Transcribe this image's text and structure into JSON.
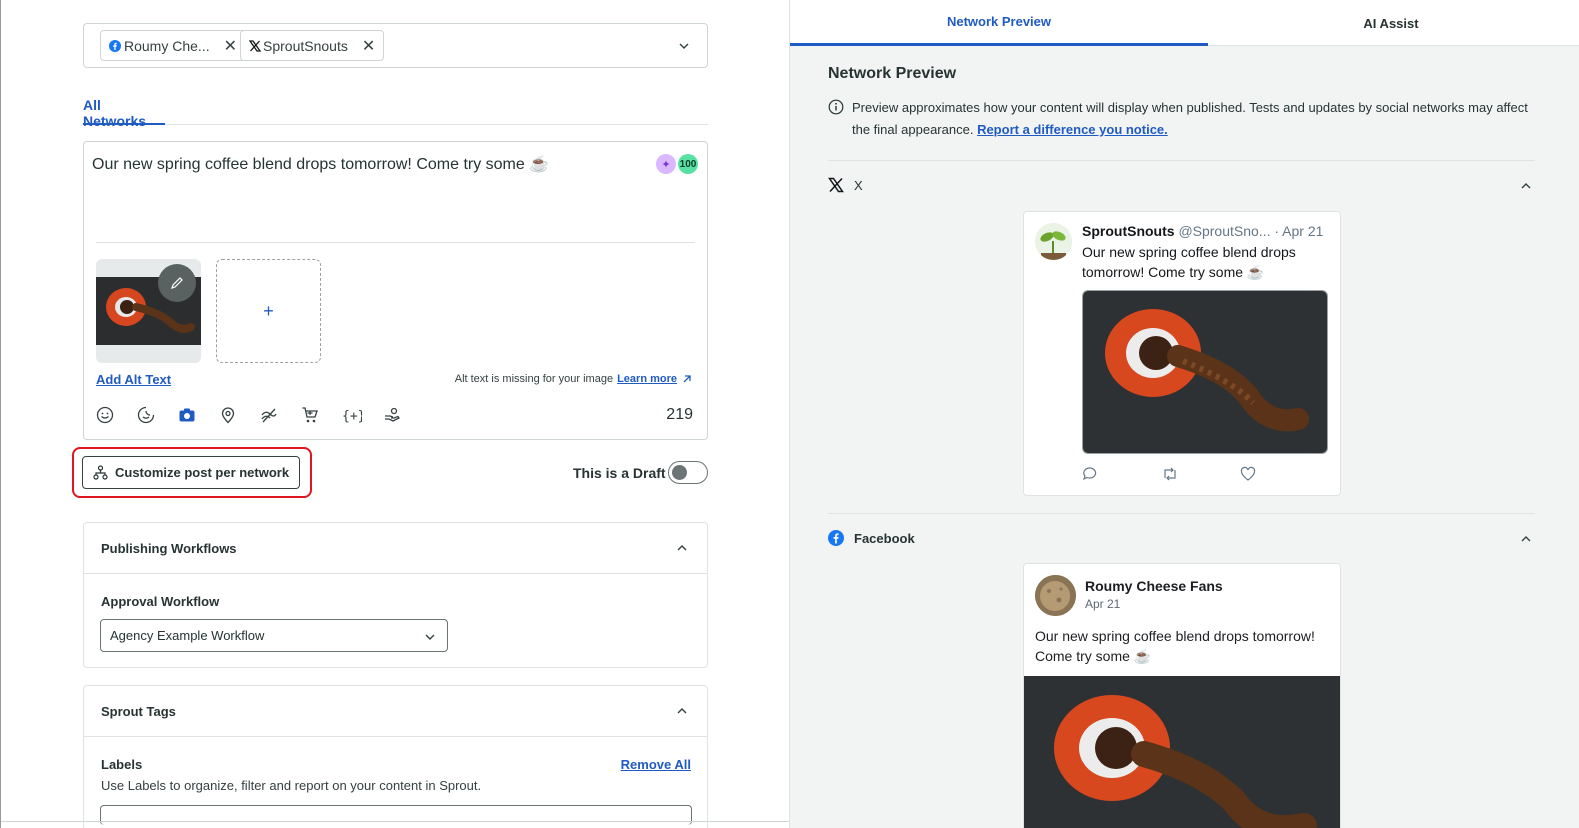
{
  "composer": {
    "profiles": [
      {
        "network": "facebook",
        "name": "Roumy Che..."
      },
      {
        "network": "x",
        "name": "SproutSnouts"
      }
    ],
    "tab_all_networks": "All Networks",
    "message": "Our new spring coffee blend drops tomorrow! Come try some ☕",
    "score": "100",
    "add_media": "+",
    "add_alt_text": "Add Alt Text",
    "alt_missing": "Alt text is missing for your image",
    "learn_more": "Learn more",
    "char_count": "219",
    "tool_icons": [
      "emoji-icon",
      "sticker-icon",
      "camera-icon",
      "location-icon",
      "link-off-icon",
      "cart-icon",
      "variables-icon",
      "hand-icon"
    ],
    "customize_button": "Customize post per network",
    "draft_label": "This is a Draft",
    "draft_on": false
  },
  "publishing_workflows": {
    "title": "Publishing Workflows",
    "approval_label": "Approval Workflow",
    "approval_value": "Agency Example Workflow"
  },
  "sprout_tags": {
    "title": "Sprout Tags",
    "labels_title": "Labels",
    "remove_all": "Remove All",
    "labels_desc": "Use Labels to organize, filter and report on your content in Sprout."
  },
  "preview": {
    "tabs": [
      "Network Preview",
      "AI Assist"
    ],
    "title": "Network Preview",
    "desc": "Preview approximates how your content will display when published. Tests and updates by social networks may affect the final appearance.",
    "report_link": "Report a difference you notice.",
    "x_section": "X",
    "x_post": {
      "name": "SproutSnouts",
      "handle": "@SproutSno...",
      "date": "· Apr 21",
      "text": "Our new spring coffee blend drops tomorrow! Come try some ☕"
    },
    "fb_section": "Facebook",
    "fb_post": {
      "name": "Roumy Cheese Fans",
      "date": "Apr 21",
      "text": "Our new spring coffee blend drops tomorrow! Come try some ☕"
    }
  },
  "colors": {
    "accent": "#205bc3",
    "highlight": "#e0151f",
    "ai_badge": "#d9b8ff",
    "score_badge": "#59e0a3"
  }
}
